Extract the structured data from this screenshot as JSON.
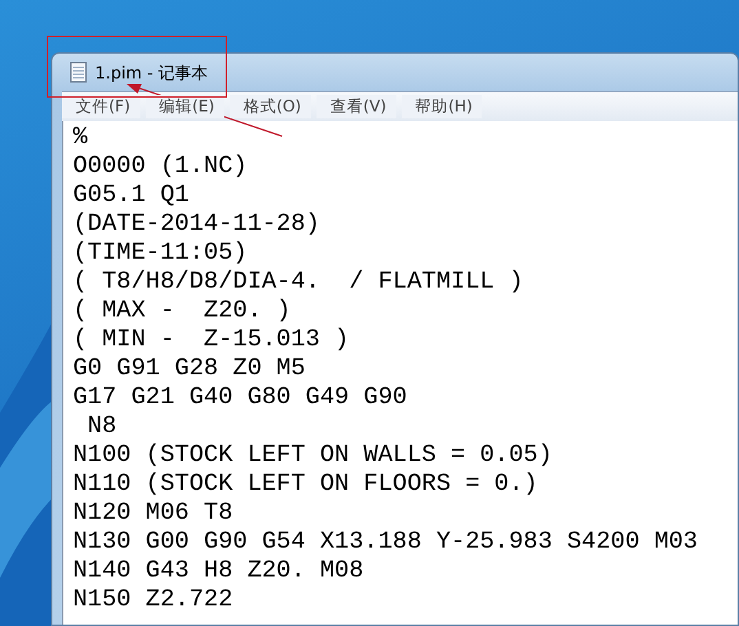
{
  "window": {
    "title": "1.pim - 记事本"
  },
  "menu": [
    "文件(F)",
    "编辑(E)",
    "格式(O)",
    "查看(V)",
    "帮助(H)"
  ],
  "lines": [
    "%",
    "O0000 (1.NC)",
    "G05.1 Q1",
    "(DATE-2014-11-28)",
    "(TIME-11:05)",
    "( T8/H8/D8/DIA-4.  / FLATMILL )",
    "( MAX -  Z20. )",
    "( MIN -  Z-15.013 )",
    "G0 G91 G28 Z0 M5",
    "G17 G21 G40 G80 G49 G90",
    " N8",
    "N100 (STOCK LEFT ON WALLS = 0.05)",
    "N110 (STOCK LEFT ON FLOORS = 0.)",
    "N120 M06 T8",
    "N130 G00 G90 G54 X13.188 Y-25.983 S4200 M03",
    "N140 G43 H8 Z20. M08",
    "N150 Z2.722"
  ]
}
